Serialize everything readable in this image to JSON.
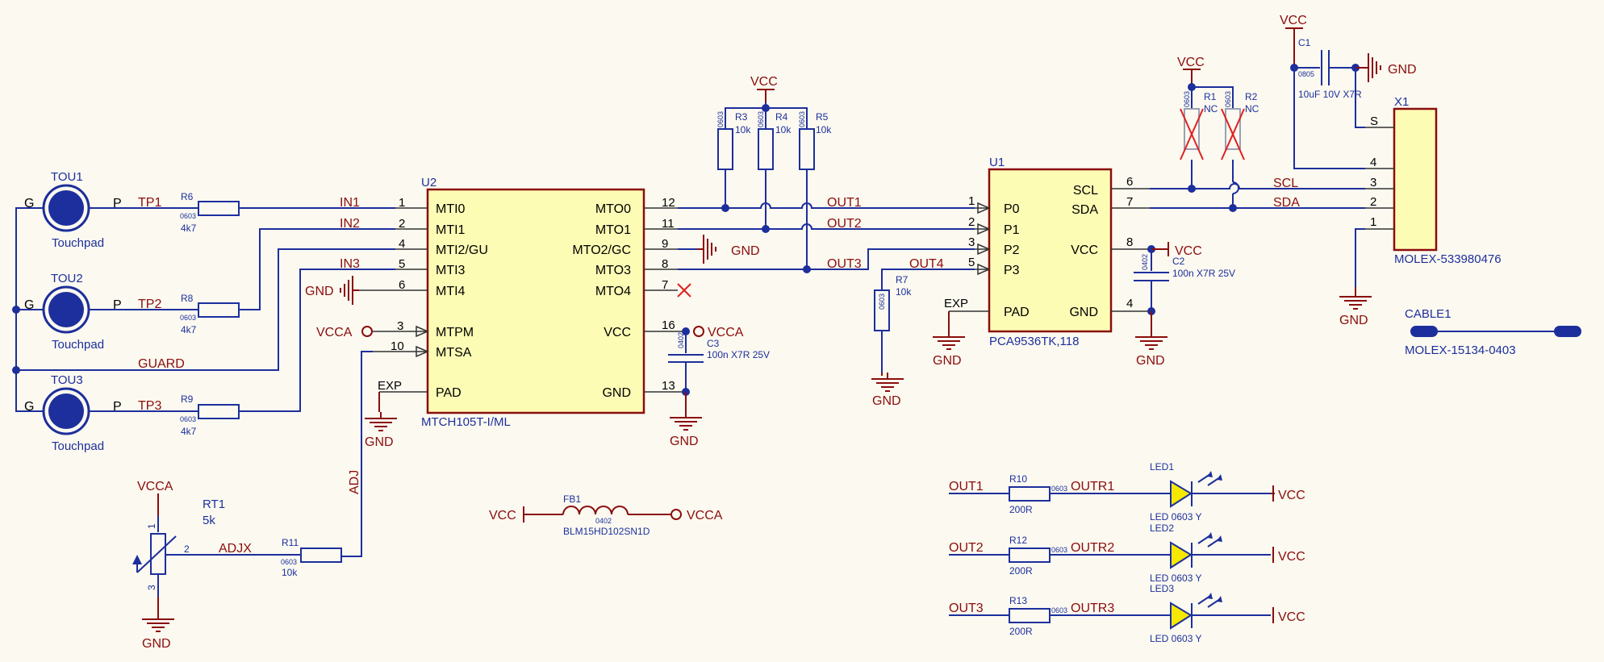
{
  "colors": {
    "wire": "#1d2f9c",
    "power": "#8b0d0d",
    "body_fill": "#fdfcb5",
    "background": "#fbf9f0",
    "no_connect": "#e02020"
  },
  "touchpads": [
    {
      "ref": "TOU1",
      "name": "Touchpad",
      "pin_g": "G",
      "pin_p": "P",
      "net": "TP1"
    },
    {
      "ref": "TOU2",
      "name": "Touchpad",
      "pin_g": "G",
      "pin_p": "P",
      "net": "TP2"
    },
    {
      "ref": "TOU3",
      "name": "Touchpad",
      "pin_g": "G",
      "pin_p": "P",
      "net": "TP3"
    }
  ],
  "resistors": {
    "R6": {
      "ref": "R6",
      "pkg": "0603",
      "value": "4k7"
    },
    "R8": {
      "ref": "R8",
      "pkg": "0603",
      "value": "4k7"
    },
    "R9": {
      "ref": "R9",
      "pkg": "0603",
      "value": "4k7"
    },
    "R3": {
      "ref": "R3",
      "pkg": "0603",
      "value": "10k"
    },
    "R4": {
      "ref": "R4",
      "pkg": "0603",
      "value": "10k"
    },
    "R5": {
      "ref": "R5",
      "pkg": "0603",
      "value": "10k"
    },
    "R7": {
      "ref": "R7",
      "pkg": "0603",
      "value": "10k"
    },
    "R1": {
      "ref": "R1",
      "pkg": "0603",
      "value": "NC"
    },
    "R2": {
      "ref": "R2",
      "pkg": "0603",
      "value": "NC"
    },
    "R11": {
      "ref": "R11",
      "pkg": "0603",
      "value": "10k"
    },
    "R10": {
      "ref": "R10",
      "pkg": "0603",
      "value": "200R"
    },
    "R12": {
      "ref": "R12",
      "pkg": "0603",
      "value": "200R"
    },
    "R13": {
      "ref": "R13",
      "pkg": "0603",
      "value": "200R"
    }
  },
  "nets": {
    "in1": "IN1",
    "in2": "IN2",
    "in3": "IN3",
    "guard": "GUARD",
    "out1": "OUT1",
    "out2": "OUT2",
    "out3": "OUT3",
    "out4": "OUT4",
    "scl": "SCL",
    "sda": "SDA",
    "adj": "ADJ",
    "adjx": "ADJX",
    "outr1": "OUTR1",
    "outr2": "OUTR2",
    "outr3": "OUTR3"
  },
  "power": {
    "vcc": "VCC",
    "vcca": "VCCA",
    "gnd": "GND"
  },
  "u2": {
    "ref": "U2",
    "part": "MTCH105T-I/ML",
    "left_pins": [
      {
        "num": "1",
        "name": "MTI0"
      },
      {
        "num": "2",
        "name": "MTI1"
      },
      {
        "num": "4",
        "name": "MTI2/GU"
      },
      {
        "num": "5",
        "name": "MTI3"
      },
      {
        "num": "6",
        "name": "MTI4"
      },
      {
        "num": "3",
        "name": "MTPM"
      },
      {
        "num": "10",
        "name": "MTSA"
      },
      {
        "num": "EXP",
        "name": "PAD"
      }
    ],
    "right_pins": [
      {
        "num": "12",
        "name": "MTO0"
      },
      {
        "num": "11",
        "name": "MTO1"
      },
      {
        "num": "9",
        "name": "MTO2/GC"
      },
      {
        "num": "8",
        "name": "MTO3"
      },
      {
        "num": "7",
        "name": "MTO4"
      },
      {
        "num": "16",
        "name": "VCC"
      },
      {
        "num": "13",
        "name": "GND"
      }
    ]
  },
  "u1": {
    "ref": "U1",
    "part": "PCA9536TK,118",
    "left_pins": [
      {
        "num": "1",
        "name": "P0"
      },
      {
        "num": "2",
        "name": "P1"
      },
      {
        "num": "3",
        "name": "P2"
      },
      {
        "num": "5",
        "name": "P3"
      },
      {
        "num": "EXP",
        "name": "PAD"
      }
    ],
    "right_pins": [
      {
        "num": "6",
        "name": "SCL"
      },
      {
        "num": "7",
        "name": "SDA"
      },
      {
        "num": "8",
        "name": "VCC"
      },
      {
        "num": "4",
        "name": "GND"
      }
    ]
  },
  "x1": {
    "ref": "X1",
    "part": "MOLEX-533980476",
    "pins": [
      {
        "num": "S",
        "name": ""
      },
      {
        "num": "4",
        "name": ""
      },
      {
        "num": "3",
        "name": "SCL"
      },
      {
        "num": "2",
        "name": "SDA"
      },
      {
        "num": "1",
        "name": ""
      }
    ]
  },
  "caps": {
    "C1": {
      "ref": "C1",
      "pkg": "0805",
      "value": "10uF 10V X7R"
    },
    "C2": {
      "ref": "C2",
      "pkg": "0402",
      "value": "100n X7R 25V"
    },
    "C3": {
      "ref": "C3",
      "pkg": "0402",
      "value": "100n X7R 25V"
    }
  },
  "rt1": {
    "ref": "RT1",
    "value": "5k",
    "pin1": "1",
    "pin2": "2",
    "pin3": "3"
  },
  "fb1": {
    "ref": "FB1",
    "pkg": "0402",
    "part": "BLM15HD102SN1D"
  },
  "leds": [
    {
      "ref": "LED1",
      "part": "LED 0603 Y"
    },
    {
      "ref": "LED2",
      "part": "LED 0603 Y"
    },
    {
      "ref": "LED3",
      "part": "LED 0603 Y"
    }
  ],
  "cable1": {
    "ref": "CABLE1",
    "part": "MOLEX-15134-0403"
  }
}
